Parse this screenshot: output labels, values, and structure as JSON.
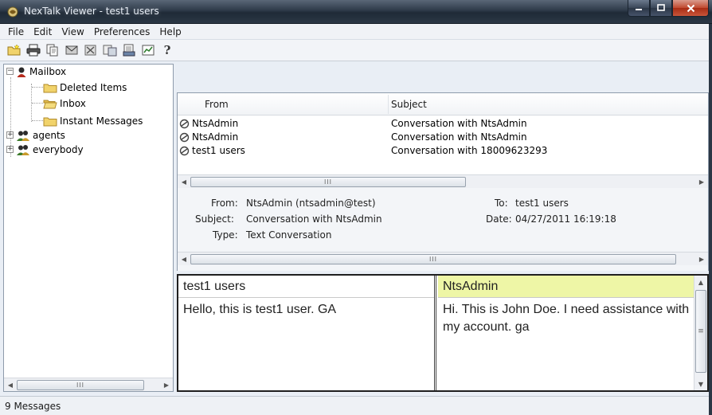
{
  "window": {
    "title": "NexTalk Viewer - test1 users",
    "minimize": "–",
    "maximize": "□",
    "close": "x"
  },
  "menu": [
    "File",
    "Edit",
    "View",
    "Preferences",
    "Help"
  ],
  "toolbar": {
    "icons": [
      "new-folder-icon",
      "print-icon",
      "copy-icon",
      "mailbox-icon",
      "delete-icon",
      "move-icon",
      "export-icon",
      "report-icon",
      "help-icon"
    ],
    "help_glyph": "?"
  },
  "tree": {
    "mailbox": "Mailbox",
    "deleted_items": "Deleted Items",
    "inbox": "Inbox",
    "instant_messages": "Instant Messages",
    "agents": "agents",
    "everybody": "everybody",
    "expand_minus": "−",
    "expand_plus": "+"
  },
  "list": {
    "columns": {
      "from": "From",
      "subject": "Subject"
    },
    "rows": [
      {
        "from": "NtsAdmin",
        "subject": "Conversation with NtsAdmin"
      },
      {
        "from": "NtsAdmin",
        "subject": "Conversation with NtsAdmin"
      },
      {
        "from": "test1 users",
        "subject": "Conversation with 18009623293"
      }
    ]
  },
  "message_header": {
    "from_label": "From:",
    "from_value": "NtsAdmin (ntsadmin@test)",
    "subject_label": "Subject:",
    "subject_value": "Conversation with NtsAdmin",
    "type_label": "Type:",
    "type_value": "Text Conversation",
    "to_label": "To:",
    "to_value": "test1 users",
    "date_label": "Date:",
    "date_value": "04/27/2011 16:19:18"
  },
  "conversation": {
    "left_name": "test1 users",
    "left_text": "Hello, this is test1 user.  GA",
    "right_name": "NtsAdmin",
    "right_text": "Hi.  This is John Doe.  I need assistance with my account. ga"
  },
  "scroll": {
    "thumb_grip": "III",
    "grip_v": "≡"
  },
  "status": {
    "text": "9 Messages"
  },
  "colors": {
    "selected_speaker_bg": "#eef6a6",
    "titlebar": "#2e3a49",
    "close_button": "#c0492f"
  }
}
